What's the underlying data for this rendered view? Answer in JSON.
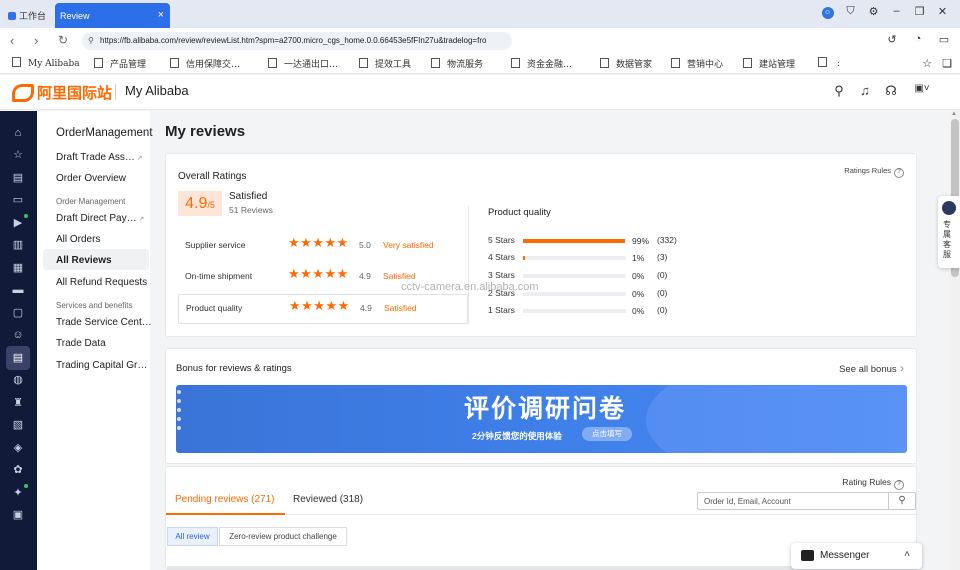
{
  "browser": {
    "tabs": [
      {
        "label": "工作台"
      },
      {
        "label": "Review",
        "close": "×"
      }
    ],
    "url": "https://fb.alibaba.com/review/reviewList.htm?spm=a2700.micro_cgs_home.0.0.66453e5fFIn27u&tradelog=fro",
    "bookmarks": [
      "My Alibaba",
      "产品管理",
      "信用保障交…",
      "一达通出口…",
      "提效工具",
      "物流服务",
      "资金金融…",
      "数据管家",
      "营销中心",
      "建站管理",
      " :"
    ]
  },
  "header": {
    "logo_text": "阿里国际站",
    "app_title": "My Alibaba"
  },
  "subnav": {
    "title": "OrderManagement",
    "items": [
      {
        "label": "Draft Trade Ass…"
      },
      {
        "label": "Order Overview"
      },
      {
        "group": "Order Management"
      },
      {
        "label": "Draft Direct Pay…"
      },
      {
        "label": "All Orders"
      },
      {
        "label": "All Reviews"
      },
      {
        "label": "All Refund Requests"
      },
      {
        "group": "Services and benefits"
      },
      {
        "label": "Trade Service Cent…"
      },
      {
        "label": "Trade Data"
      },
      {
        "label": "Trading Capital Gr…"
      }
    ]
  },
  "page": {
    "title": "My reviews"
  },
  "overall": {
    "title": "Overall Ratings",
    "rules_link": "Ratings Rules",
    "score": "4.9",
    "score_suffix": "/5",
    "verdict": "Satisfied",
    "review_count": "51 Reviews",
    "rows": [
      {
        "label": "Supplier service",
        "stars": 5,
        "value": "5.0",
        "verdict": "Very satisfied"
      },
      {
        "label": "On-time shipment",
        "stars": 5,
        "value": "4.9",
        "verdict": "Satisfied"
      },
      {
        "label": "Product quality",
        "stars": 5,
        "value": "4.9",
        "verdict": "Satisfied"
      }
    ]
  },
  "product_quality": {
    "title": "Product quality",
    "bars": [
      {
        "label": "5 Stars",
        "fraction": 0.99,
        "pct": "99%",
        "count": "(332)"
      },
      {
        "label": "4 Stars",
        "fraction": 0.01,
        "pct": "1%",
        "count": "(3)"
      },
      {
        "label": "3 Stars",
        "fraction": 0,
        "pct": "0%",
        "count": "(0)"
      },
      {
        "label": "2 Stars",
        "fraction": 0,
        "pct": "0%",
        "count": "(0)"
      },
      {
        "label": "1 Stars",
        "fraction": 0,
        "pct": "0%",
        "count": "(0)"
      }
    ]
  },
  "watermark": "cctv-camera.en.alibaba.com",
  "bonus": {
    "title": "Bonus for reviews & ratings",
    "see_all": "See all bonus",
    "banner_title": "评价调研问卷",
    "banner_sub": "2分钟反馈您的使用体验",
    "banner_button": "点击填写"
  },
  "reviews": {
    "rules_link": "Rating Rules",
    "tabs": [
      {
        "label": "Pending reviews (271)",
        "active": true
      },
      {
        "label": "Reviewed (318)",
        "active": false
      }
    ],
    "search_placeholder": "Order Id, Email, Account",
    "filters": [
      {
        "label": "All review",
        "active": true
      },
      {
        "label": "Zero-review product challenge",
        "active": false
      }
    ]
  },
  "messenger": {
    "label": "Messenger"
  },
  "kefu": {
    "label": "专属客服"
  },
  "colors": {
    "accent": "#ff6a00",
    "rail": "#121a39",
    "browser_tab": "#2d6fe8",
    "banner": "#3f80ea"
  }
}
